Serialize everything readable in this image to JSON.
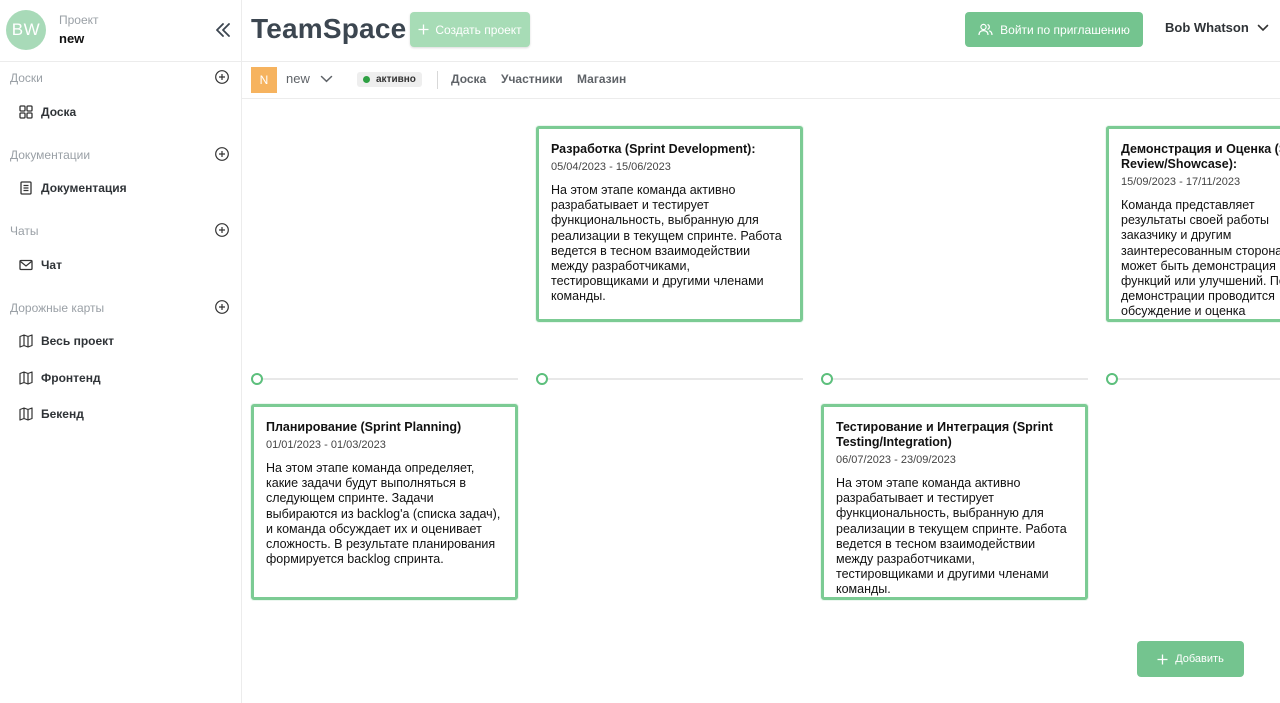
{
  "sidebar": {
    "avatar_initials": "BW",
    "project_label": "Проект",
    "project_name": "new",
    "sections": [
      {
        "title": "Доски",
        "items": [
          {
            "label": "Доска",
            "icon": "grid-icon"
          }
        ]
      },
      {
        "title": "Документации",
        "items": [
          {
            "label": "Документация",
            "icon": "document-icon"
          }
        ]
      },
      {
        "title": "Чаты",
        "items": [
          {
            "label": "Чат",
            "icon": "mail-icon"
          }
        ]
      },
      {
        "title": "Дорожные карты",
        "items": [
          {
            "label": "Весь проект",
            "icon": "map-icon"
          },
          {
            "label": "Фронтенд",
            "icon": "map-icon"
          },
          {
            "label": "Бекенд",
            "icon": "map-icon"
          }
        ]
      }
    ]
  },
  "header": {
    "app_title": "TeamSpace",
    "create_button": "Создать проект",
    "invite_button": "Войти по приглашению",
    "user_name": "Bob Whatson"
  },
  "subbar": {
    "project_initial": "N",
    "project_name": "new",
    "status": "активно",
    "tabs": [
      "Доска",
      "Участники",
      "Магазин"
    ]
  },
  "roadmap": {
    "cards": [
      {
        "title": "Разработка (Sprint Development):",
        "dates": "05/04/2023 - 15/06/2023",
        "text": "На этом этапе команда активно разрабатывает и тестирует функциональность, выбранную для реализации в текущем спринте. Работа ведется в тесном взаимодействии между разработчиками, тестировщиками и другими членами команды."
      },
      {
        "title": "Демонстрация и Оценка (Sprint Review/Showcase):",
        "dates": "15/09/2023 - 17/11/2023",
        "text": "Команда представляет результаты своей работы заказчику и другим заинтересованным сторонам. Это может быть демонстрация новых функций или улучшений. После демонстрации проводится обсуждение и оценка выполненной работы."
      },
      {
        "title": "Планирование (Sprint Planning)",
        "dates": "01/01/2023 - 01/03/2023",
        "text": "На этом этапе команда определяет, какие задачи будут выполняться в следующем спринте. Задачи выбираются из backlog'а (списка задач), и команда обсуждает их и оценивает сложность. В результате планирования формируется backlog спринта."
      },
      {
        "title": "Тестирование и Интеграция (Sprint Testing/Integration)",
        "dates": "06/07/2023 - 23/09/2023",
        "text": "На этом этапе команда активно разрабатывает и тестирует функциональность, выбранную для реализации в текущем спринте. Работа ведется в тесном взаимодействии между разработчиками, тестировщиками и другими членами команды."
      }
    ],
    "add_button": "Добавить"
  },
  "colors": {
    "accent": "#74c48f",
    "accent_light": "#a7dcb6",
    "card_border": "#7ccb94",
    "project_badge": "#f6b35f",
    "avatar": "#a8dab8"
  }
}
